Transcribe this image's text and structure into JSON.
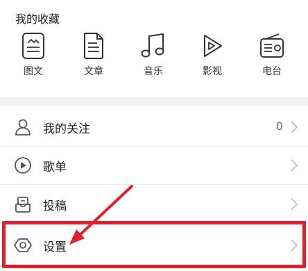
{
  "favorites": {
    "title": "我的收藏",
    "items": [
      {
        "label": "图文",
        "icon": "image-text-icon"
      },
      {
        "label": "文章",
        "icon": "article-icon"
      },
      {
        "label": "音乐",
        "icon": "music-note-icon"
      },
      {
        "label": "影视",
        "icon": "video-play-icon"
      },
      {
        "label": "电台",
        "icon": "radio-icon"
      }
    ]
  },
  "menu": {
    "follow": {
      "label": "我的关注",
      "count": "0",
      "icon": "user-icon"
    },
    "playlist": {
      "label": "歌单",
      "icon": "play-circle-icon"
    },
    "submit": {
      "label": "投稿",
      "icon": "submit-icon"
    },
    "settings": {
      "label": "设置",
      "icon": "hexagon-settings-icon"
    }
  },
  "annotation": {
    "color": "#e0202a"
  }
}
